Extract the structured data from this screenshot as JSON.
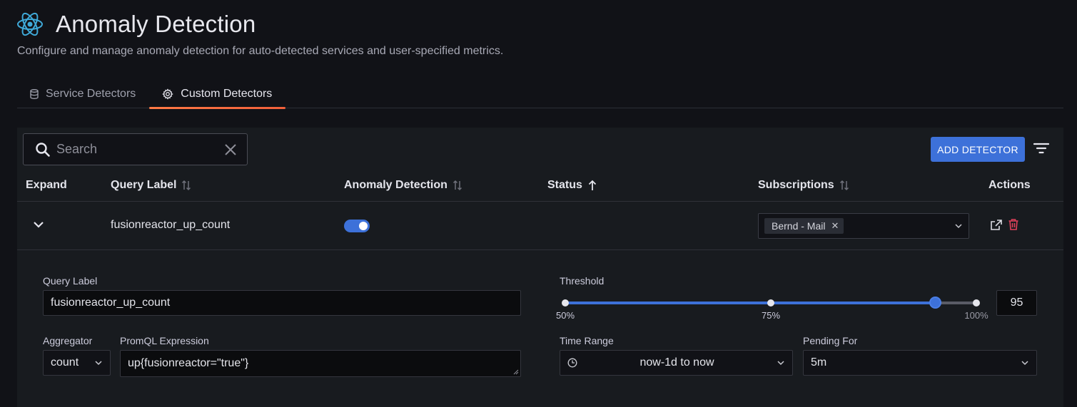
{
  "page": {
    "title": "Anomaly Detection",
    "subtitle": "Configure and manage anomaly detection for auto-detected services and user-specified metrics."
  },
  "tabs": [
    {
      "label": "Service Detectors",
      "icon": "database-icon",
      "active": false
    },
    {
      "label": "Custom Detectors",
      "icon": "gear-icon",
      "active": true
    }
  ],
  "toolbar": {
    "search_placeholder": "Search",
    "add_button": "ADD DETECTOR"
  },
  "table": {
    "columns": [
      "Expand",
      "Query Label",
      "Anomaly Detection",
      "Status",
      "Subscriptions",
      "Actions"
    ],
    "rows": [
      {
        "query_label": "fusionreactor_up_count",
        "anomaly_detection_enabled": true,
        "status": "",
        "subscriptions": [
          "Bernd - Mail"
        ]
      }
    ]
  },
  "details": {
    "query_label_label": "Query Label",
    "query_label_value": "fusionreactor_up_count",
    "threshold_label": "Threshold",
    "threshold_value": "95",
    "threshold_marks": [
      "50%",
      "75%",
      "100%"
    ],
    "threshold_min": 50,
    "threshold_max": 100,
    "aggregator_label": "Aggregator",
    "aggregator_value": "count",
    "promql_label": "PromQL Expression",
    "promql_value": "up{fusionreactor=\"true\"}",
    "time_range_label": "Time Range",
    "time_range_value": "now-1d to now",
    "pending_for_label": "Pending For",
    "pending_for_value": "5m"
  },
  "colors": {
    "accent": "#3d71d9",
    "tab_underline": "#f2603a",
    "delete": "#e0415a"
  }
}
